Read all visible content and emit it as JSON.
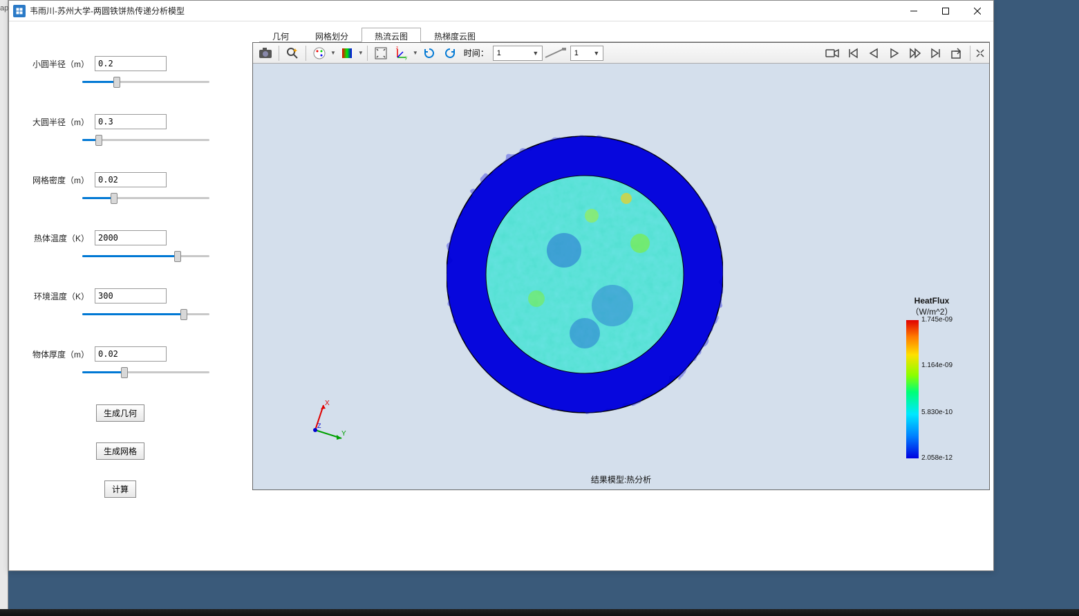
{
  "window": {
    "title": "韦雨川-苏州大学-两圆铁饼热传递分析模型",
    "behind_label": "ap"
  },
  "parameters": [
    {
      "label": "小圆半径（m）",
      "value": "0.2",
      "slider_pct": 27
    },
    {
      "label": "大圆半径（m）",
      "value": "0.3",
      "slider_pct": 13
    },
    {
      "label": "网格密度（m）",
      "value": "0.02",
      "slider_pct": 25
    },
    {
      "label": "热体温度（K）",
      "value": "2000",
      "slider_pct": 75
    },
    {
      "label": "环境温度（K）",
      "value": "300",
      "slider_pct": 80
    },
    {
      "label": "物体厚度（m）",
      "value": "0.02",
      "slider_pct": 33
    }
  ],
  "buttons": {
    "gen_geometry": "生成几何",
    "gen_mesh": "生成网格",
    "compute": "计算"
  },
  "tabs": [
    {
      "label": "几何",
      "active": false
    },
    {
      "label": "网格划分",
      "active": false
    },
    {
      "label": "热流云图",
      "active": true
    },
    {
      "label": "热梯度云图",
      "active": false
    }
  ],
  "toolbar": {
    "time_label": "时间：",
    "time_combo": "1",
    "step_combo": "1"
  },
  "legend": {
    "title": "HeatFlux",
    "unit": "（W/m^2）",
    "ticks": [
      {
        "value": "1.745e-09",
        "pos": 0
      },
      {
        "value": "1.164e-09",
        "pos": 33
      },
      {
        "value": "5.830e-10",
        "pos": 67
      },
      {
        "value": "2.058e-12",
        "pos": 100
      }
    ]
  },
  "footer": "结果模型:热分析",
  "axis": {
    "x": "X",
    "y": "Y",
    "z": "Z"
  },
  "chart_data": {
    "type": "heatmap",
    "title": "结果模型:热分析",
    "quantity": "HeatFlux",
    "unit": "W/m^2",
    "geometry": {
      "shape": "annulus_with_inner_disk",
      "outer_radius": 0.3,
      "inner_radius": 0.2
    },
    "color_range": {
      "min": 2.058e-12,
      "max": 1.745e-09
    },
    "color_ticks": [
      2.058e-12,
      5.83e-10,
      1.164e-09,
      1.745e-09
    ],
    "regions": [
      {
        "name": "outer_ring",
        "approx_value": 2e-12,
        "note": "mostly uniform near min"
      },
      {
        "name": "inner_disk",
        "approx_value": 5e-10,
        "note": "mottled cyan-green, mid range"
      }
    ]
  }
}
